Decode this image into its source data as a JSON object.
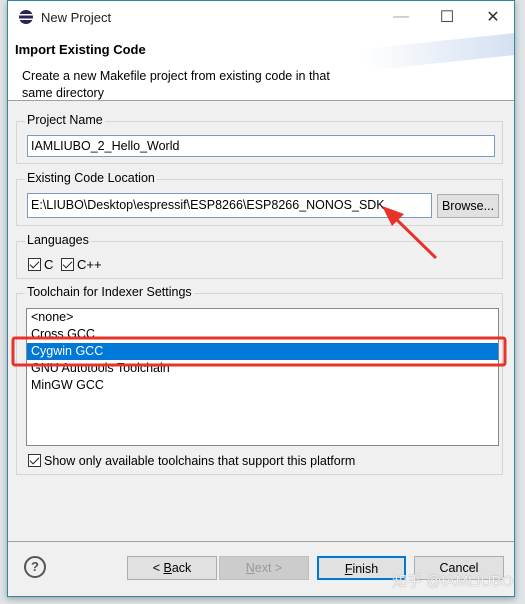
{
  "window": {
    "title": "New Project",
    "minimize": "—",
    "maximize": "☐",
    "close": "✕"
  },
  "header": {
    "title": "Import Existing Code",
    "description": "Create a new Makefile project from existing code in that same directory"
  },
  "project_name": {
    "label": "Project Name",
    "value": "IAMLIUBO_2_Hello_World"
  },
  "code_location": {
    "label": "Existing Code Location",
    "value": "E:\\LIUBO\\Desktop\\espressif\\ESP8266\\ESP8266_NONOS_SDK",
    "browse": "Browse..."
  },
  "languages": {
    "label": "Languages",
    "items": [
      {
        "label": "C",
        "checked": true
      },
      {
        "label": "C++",
        "checked": true
      }
    ]
  },
  "toolchain": {
    "label": "Toolchain for Indexer Settings",
    "items": [
      "<none>",
      "Cross GCC",
      "Cygwin GCC",
      "GNU Autotools Toolchain",
      "MinGW GCC"
    ],
    "selected": "Cygwin GCC",
    "show_only_label": "Show only available toolchains that support this platform",
    "show_only_checked": true
  },
  "buttons": {
    "help": "?",
    "back_prefix": "< ",
    "back_key": "B",
    "back_rest": "ack",
    "next_key": "N",
    "next_rest": "ext >",
    "finish_key": "F",
    "finish_rest": "inish",
    "cancel": "Cancel"
  },
  "watermark": "知乎 @IAMLIUBO",
  "colors": {
    "accent": "#0078d7",
    "annotation": "#e8322a"
  }
}
